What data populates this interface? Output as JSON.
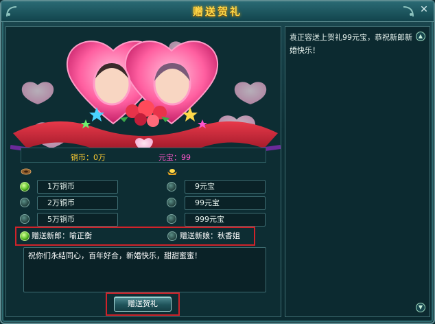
{
  "window": {
    "title": "赠送贺礼",
    "close_glyph": "✕"
  },
  "currency": {
    "copper": "铜币：0万",
    "gold": "元宝：99",
    "copper_icon": "copper-coin-icon",
    "gold_icon": "gold-ingot-icon"
  },
  "copper_options": [
    {
      "label": "1万铜币",
      "selected": true
    },
    {
      "label": "2万铜币",
      "selected": false
    },
    {
      "label": "5万铜币",
      "selected": false
    }
  ],
  "gold_options": [
    {
      "label": "9元宝",
      "selected": false
    },
    {
      "label": "99元宝",
      "selected": false
    },
    {
      "label": "999元宝",
      "selected": false
    }
  ],
  "target": {
    "groom_label": "赠送新郎：喻正衡",
    "bride_label": "赠送新娘：秋香姐",
    "groom_selected": true,
    "bride_selected": false
  },
  "wish": {
    "text": "祝你们永结同心，百年好合，新婚快乐，甜甜蜜蜜！"
  },
  "send_button": {
    "label": "赠送贺礼"
  },
  "message_panel": {
    "text": "袁正容送上贺礼99元宝，恭祝新郎新婚快乐！"
  },
  "colors": {
    "accent_title": "#ffd94a",
    "highlight_border": "#d0232a",
    "gold_text": "#ff55cc",
    "copper_text": "#ffcc33"
  }
}
